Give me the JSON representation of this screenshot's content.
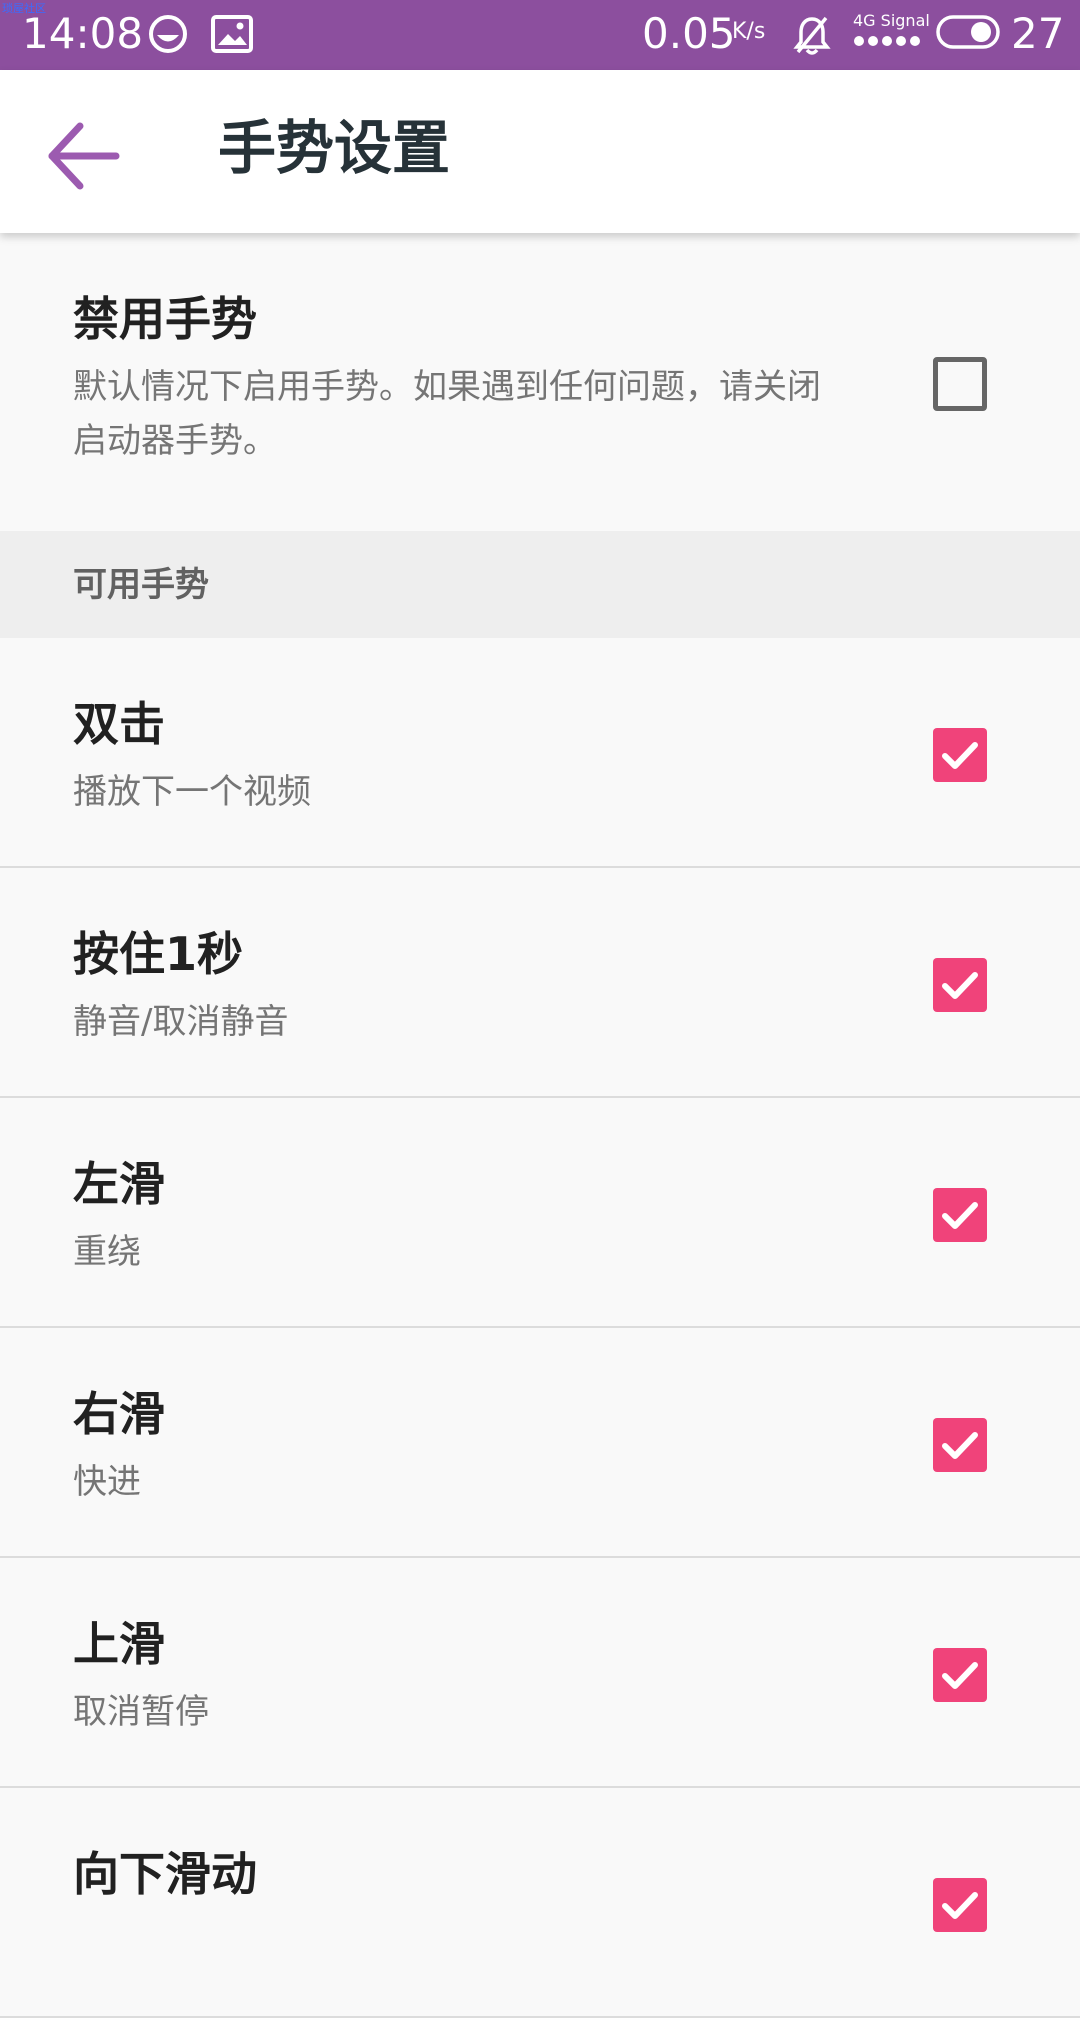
{
  "status_bar": {
    "watermark": "琐屋社区",
    "time": "14:08",
    "net_speed": "0.05",
    "net_speed_unit": "K/s",
    "signal_label": "4G Signal",
    "battery": "27",
    "background": "#8c4f9e"
  },
  "app_bar": {
    "title": "手势设置",
    "back_icon": "arrow-back-icon"
  },
  "disable_gestures": {
    "title": "禁用手势",
    "summary_line1": "默认情况下启用手势。如果遇到任何问题，请关闭",
    "summary_line2": "启动器手势。",
    "checked": false
  },
  "section_header": "可用手势",
  "gestures": [
    {
      "title": "双击",
      "summary": "播放下一个视频",
      "checked": true
    },
    {
      "title": "按住1秒",
      "summary": "静音/取消静音",
      "checked": true
    },
    {
      "title": "左滑",
      "summary": "重绕",
      "checked": true
    },
    {
      "title": "右滑",
      "summary": "快进",
      "checked": true
    },
    {
      "title": "上滑",
      "summary": "取消暂停",
      "checked": true
    },
    {
      "title": "向下滑动",
      "summary": "",
      "checked": true
    }
  ],
  "colors": {
    "accent": "#f0437a",
    "back_arrow": "#9c5bb0"
  }
}
